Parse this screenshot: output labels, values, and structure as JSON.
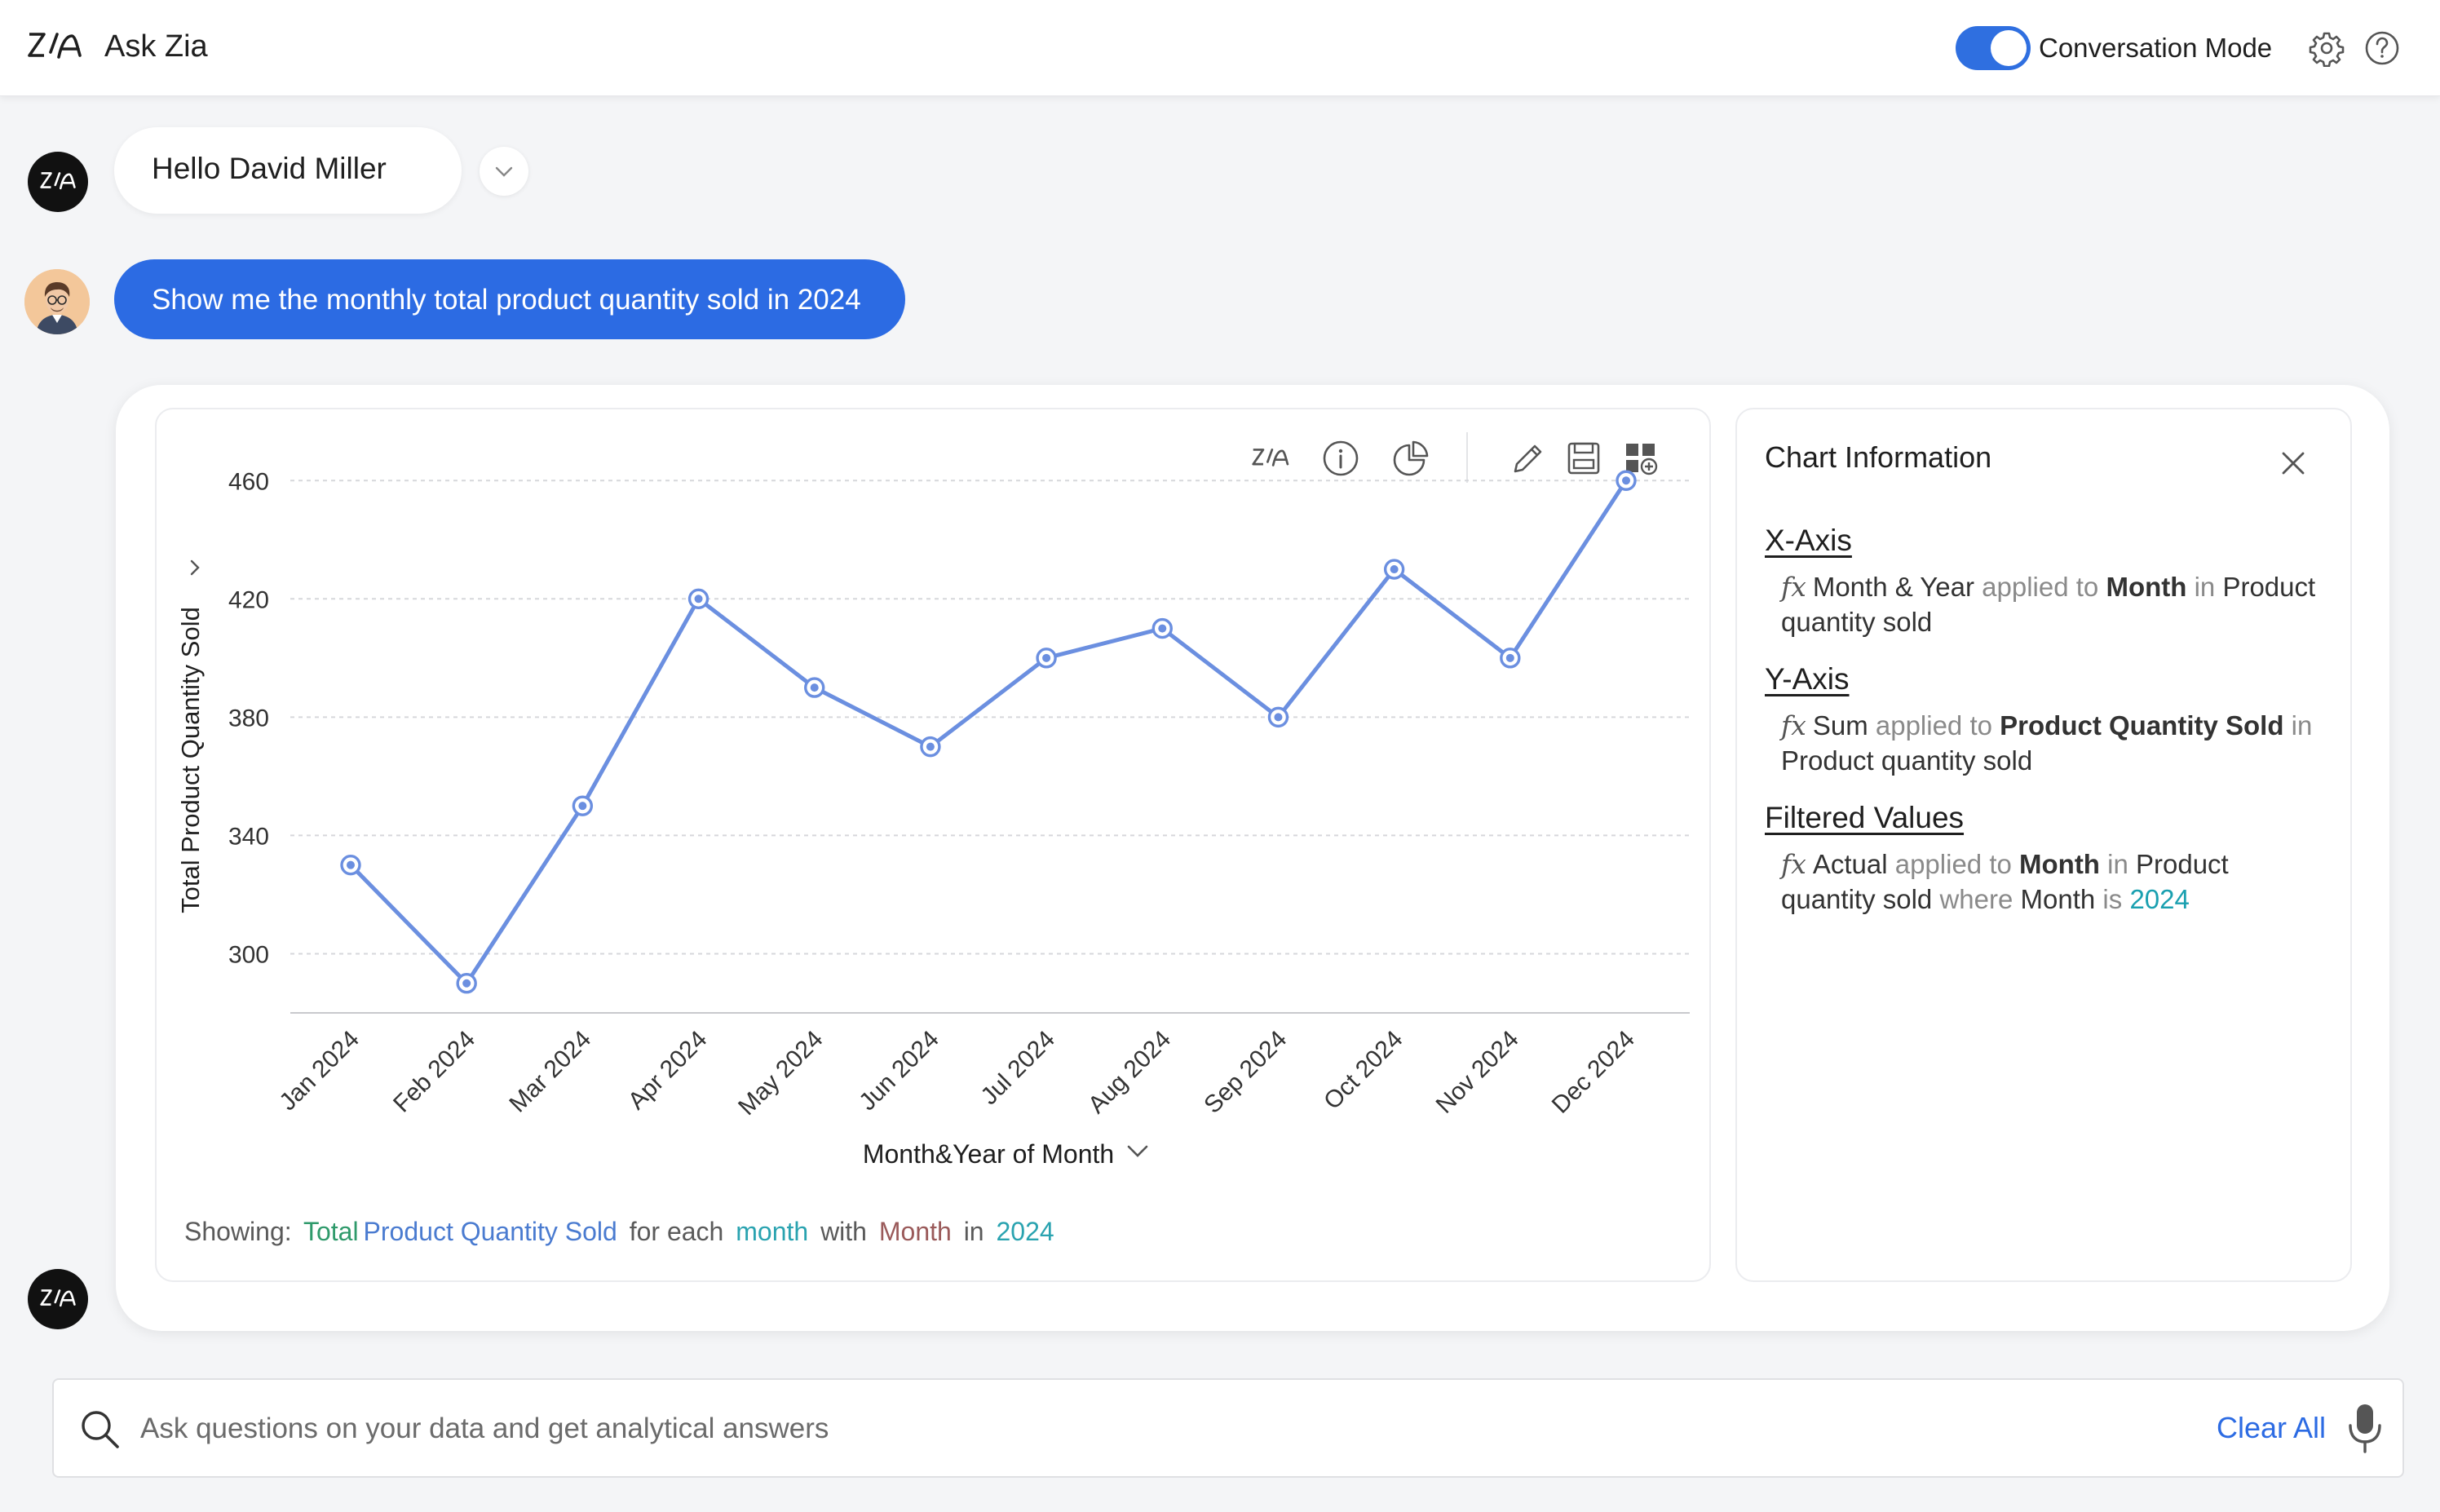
{
  "header": {
    "app_title": "Ask Zia",
    "conversation_mode_label": "Conversation Mode",
    "conversation_mode_on": true,
    "icons": [
      "zia-logo-icon",
      "gear-icon",
      "help-icon"
    ]
  },
  "chat": {
    "greeting": "Hello David Miller",
    "user_query": "Show me the monthly total product quantity sold in 2024"
  },
  "chart_toolbar": {
    "icons": [
      "zia-icon",
      "info-icon",
      "pie-chart-icon",
      "edit-icon",
      "save-icon",
      "add-to-dashboard-icon"
    ]
  },
  "chart_data": {
    "type": "line",
    "title": "",
    "xlabel": "Month&Year of Month",
    "ylabel": "Total Product Quantity Sold",
    "categories": [
      "Jan 2024",
      "Feb 2024",
      "Mar 2024",
      "Apr 2024",
      "May 2024",
      "Jun 2024",
      "Jul 2024",
      "Aug 2024",
      "Sep 2024",
      "Oct 2024",
      "Nov 2024",
      "Dec 2024"
    ],
    "series": [
      {
        "values": [
          330,
          290,
          350,
          420,
          390,
          370,
          400,
          410,
          380,
          430,
          400,
          460
        ]
      }
    ],
    "yticks": [
      300,
      340,
      380,
      420,
      460
    ],
    "ylim": [
      280,
      462
    ],
    "grid": true,
    "color": "#6b8fe0"
  },
  "showing": {
    "label": "Showing:",
    "measure_part1": "Total",
    "measure_part2": "Product Quantity Sold",
    "text_for_each": "for each",
    "dim": "month",
    "text_with": "with",
    "filter_field": "Month",
    "text_in": "in",
    "filter_value": "2024"
  },
  "chart_info": {
    "title": "Chart Information",
    "x_axis": {
      "heading": "X-Axis",
      "fx": "fx",
      "func": "Month & Year",
      "applied_to": "applied to",
      "field": "Month",
      "in": "in",
      "table": "Product quantity sold"
    },
    "y_axis": {
      "heading": "Y-Axis",
      "fx": "fx",
      "func": "Sum",
      "applied_to": "applied to",
      "field": "Product Quantity Sold",
      "in": "in",
      "table": "Product quantity sold"
    },
    "filtered": {
      "heading": "Filtered Values",
      "fx": "fx",
      "func": "Actual",
      "applied_to": "applied to",
      "field": "Month",
      "in": "in",
      "table": "Product quantity sold",
      "where": "where",
      "where_field": "Month",
      "is": "is",
      "value": "2024"
    }
  },
  "search": {
    "placeholder": "Ask questions on your data and get analytical answers",
    "value": "",
    "clear_label": "Clear All"
  }
}
